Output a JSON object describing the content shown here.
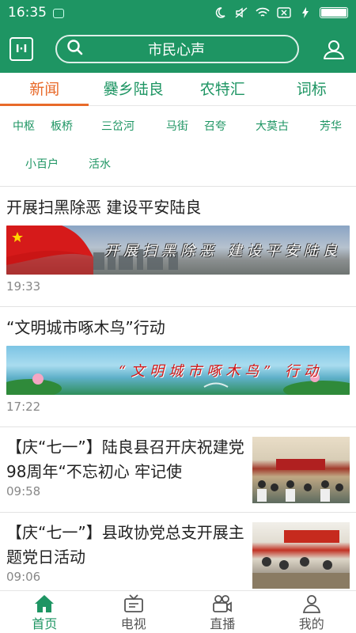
{
  "status": {
    "time": "16:35"
  },
  "header": {
    "logo_text": "I·I",
    "search_text": "市民心声"
  },
  "tabs": [
    {
      "label": "新闻"
    },
    {
      "label": "爨乡陆良"
    },
    {
      "label": "农特汇"
    },
    {
      "label": "词标"
    }
  ],
  "subcats": [
    "中枢",
    "板桥",
    "三岔河",
    "马街",
    "召夸",
    "大莫古",
    "芳华",
    "小百户",
    "活水"
  ],
  "news": [
    {
      "title": "开展扫黑除恶  建设平安陆良",
      "banner_text": "开展扫黑除恶  建设平安陆良",
      "time": "19:33"
    },
    {
      "title": "“文明城市啄木鸟”行动",
      "banner_text": "“文明城市啄木鸟”  行动",
      "time": "17:22"
    },
    {
      "title": "【庆“七一”】陆良县召开庆祝建党98周年“不忘初心 牢记使",
      "time": "09:58"
    },
    {
      "title": "【庆“七一”】县政协党总支开展主题党日活动",
      "time": "09:06"
    }
  ],
  "bottomnav": [
    {
      "label": "首页",
      "icon": "home-icon"
    },
    {
      "label": "电视",
      "icon": "tv-icon"
    },
    {
      "label": "直播",
      "icon": "camera-icon"
    },
    {
      "label": "我的",
      "icon": "person-icon"
    }
  ],
  "colors": {
    "brand": "#1e9563",
    "accent": "#e86a2a"
  }
}
